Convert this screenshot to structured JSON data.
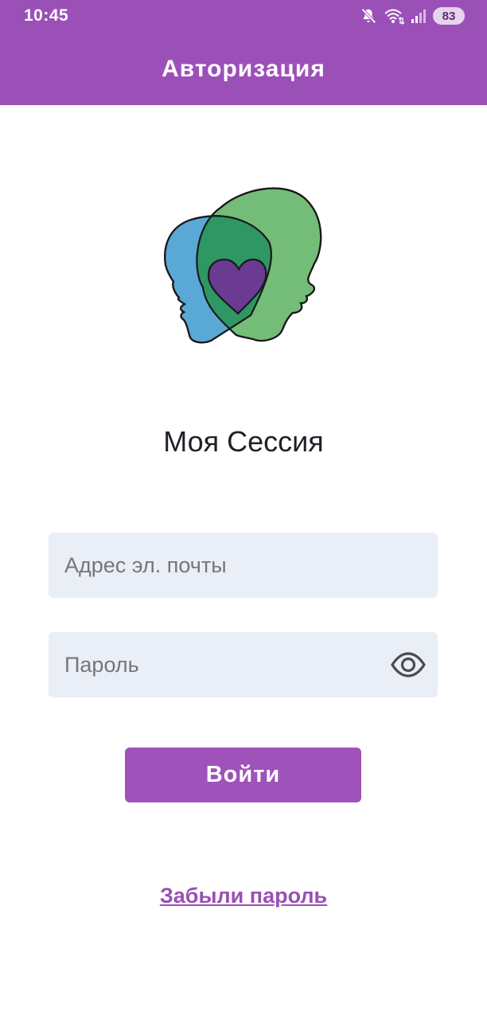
{
  "status_bar": {
    "time": "10:45",
    "battery": "83",
    "icons": [
      "mute-icon",
      "wifi-icon",
      "signal-icon",
      "battery-icon"
    ]
  },
  "app_bar": {
    "title": "Авторизация"
  },
  "logo": {
    "icon": "two-heads-heart-logo",
    "colors": {
      "blue_head": "#5aa8d6",
      "green_head": "#74bd78",
      "overlap": "#2e9763",
      "heart": "#6b3a93"
    }
  },
  "app_name": "Моя Сессия",
  "form": {
    "email_placeholder": "Адрес эл. почты",
    "email_value": "",
    "password_placeholder": "Пароль",
    "password_value": "",
    "show_password_icon": "eye-icon",
    "login_label": "Войти"
  },
  "forgot_password_label": "Забыли пароль",
  "colors": {
    "primary": "#9b50b8",
    "field_background": "#eaeef6",
    "link": "#9b4fb4"
  }
}
